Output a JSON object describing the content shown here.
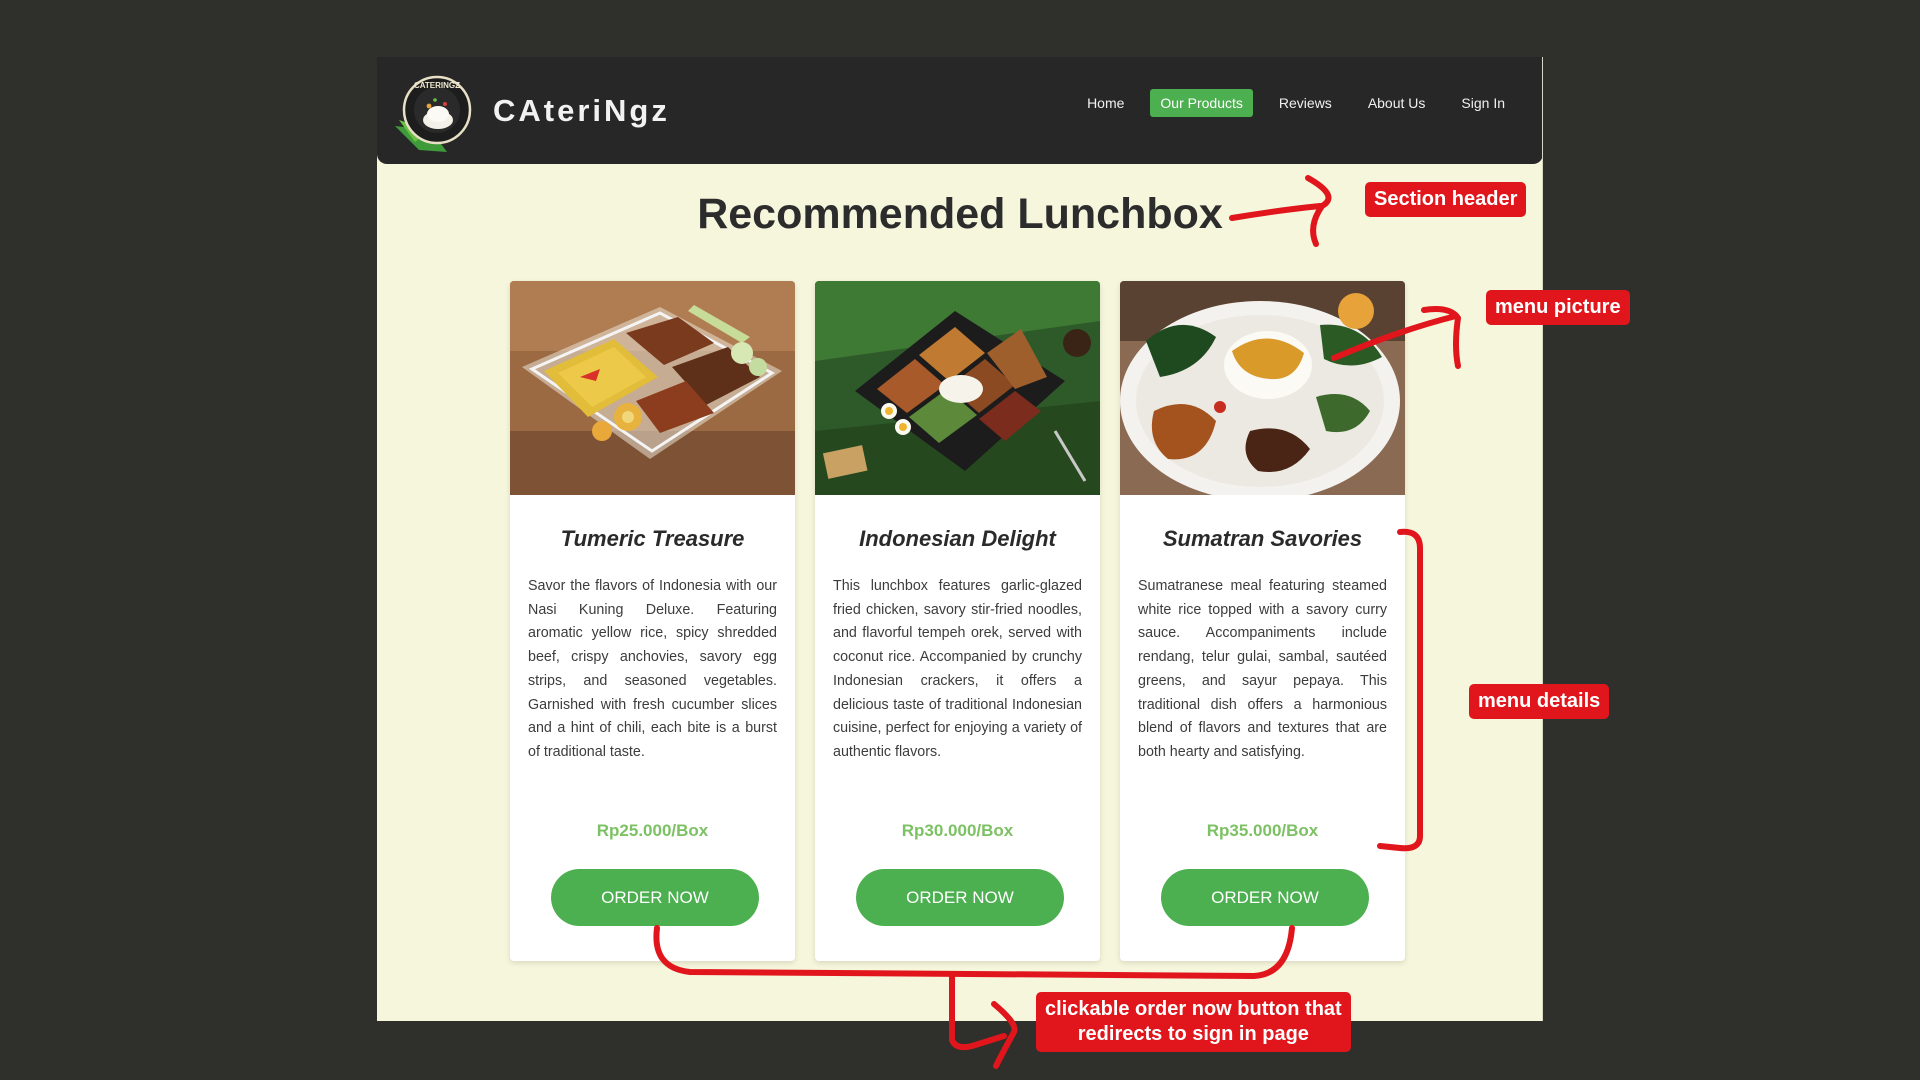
{
  "navbar": {
    "brand": "CAteriNgz",
    "logo_text": "CATERINGZ",
    "links": [
      {
        "label": "Home"
      },
      {
        "label": "Our Products",
        "active": true
      },
      {
        "label": "Reviews"
      },
      {
        "label": "About Us"
      },
      {
        "label": "Sign In"
      }
    ]
  },
  "section": {
    "title": "Recommended Lunchbox"
  },
  "cards": [
    {
      "name": "Tumeric Treasure",
      "description": "Savor the flavors of Indonesia with our Nasi Kuning Deluxe. Featuring aromatic yellow rice, spicy shredded beef, crispy anchovies, savory egg strips, and seasoned vegetables. Garnished with fresh cucumber slices and a hint of chili, each bite is a burst of traditional taste.",
      "price": "Rp25.000/Box",
      "button": "ORDER NOW"
    },
    {
      "name": "Indonesian Delight",
      "description": "This lunchbox features garlic-glazed fried chicken, savory stir-fried noodles, and flavorful tempeh orek, served with coconut rice. Accompanied by crunchy Indonesian crackers, it offers a delicious taste of traditional Indonesian cuisine, perfect for enjoying a variety of authentic flavors.",
      "price": "Rp30.000/Box",
      "button": "ORDER NOW"
    },
    {
      "name": "Sumatran Savories",
      "description": "Sumatranese meal featuring steamed white rice topped with a savory curry sauce. Accompaniments include rendang, telur gulai, sambal, sautéed greens, and sayur pepaya. This traditional dish offers a harmonious blend of flavors and textures that are both hearty and satisfying.",
      "price": "Rp35.000/Box",
      "button": "ORDER NOW"
    }
  ],
  "annotations": {
    "section_header": "Section header",
    "menu_picture": "menu picture",
    "menu_details": "menu details",
    "order_button_line1": "clickable order now button that",
    "order_button_line2": "redirects to sign in page"
  },
  "colors": {
    "accent": "#4caf50",
    "price": "#7cc163",
    "navbar": "#272727",
    "page_bg": "#f6f6dc",
    "annotation": "#e0161c"
  }
}
